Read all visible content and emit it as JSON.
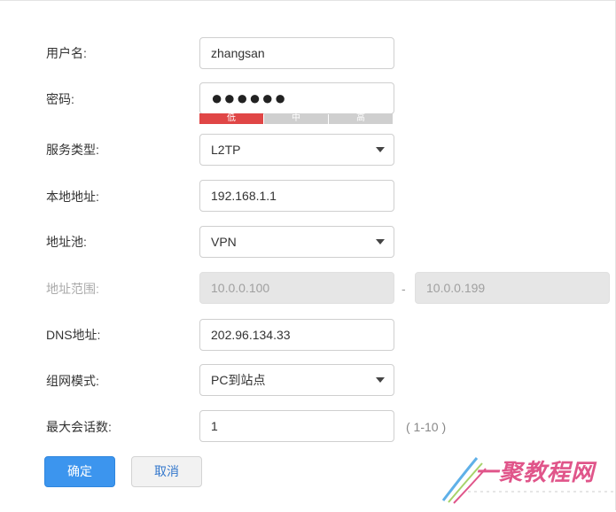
{
  "form": {
    "username": {
      "label": "用户名:",
      "value": "zhangsan"
    },
    "password": {
      "label": "密码:",
      "value": "●●●●●●",
      "strength": {
        "low": "低",
        "mid": "中",
        "high": "高",
        "level": "low"
      }
    },
    "service_type": {
      "label": "服务类型:",
      "value": "L2TP"
    },
    "local_address": {
      "label": "本地地址:",
      "value": "192.168.1.1"
    },
    "address_pool": {
      "label": "地址池:",
      "value": "VPN"
    },
    "address_range": {
      "label": "地址范围:",
      "start": "10.0.0.100",
      "separator": "-",
      "end": "10.0.0.199"
    },
    "dns_address": {
      "label": "DNS地址:",
      "value": "202.96.134.33"
    },
    "network_mode": {
      "label": "组网模式:",
      "value": "PC到站点"
    },
    "max_sessions": {
      "label": "最大会话数:",
      "value": "1",
      "hint": "( 1-10 )"
    }
  },
  "buttons": {
    "confirm": "确定",
    "cancel": "取消"
  },
  "watermark": {
    "text": "一聚教程网"
  },
  "colors": {
    "primary": "#3c95ee",
    "strength_low": "#e04646",
    "watermark": "#e0558a"
  }
}
